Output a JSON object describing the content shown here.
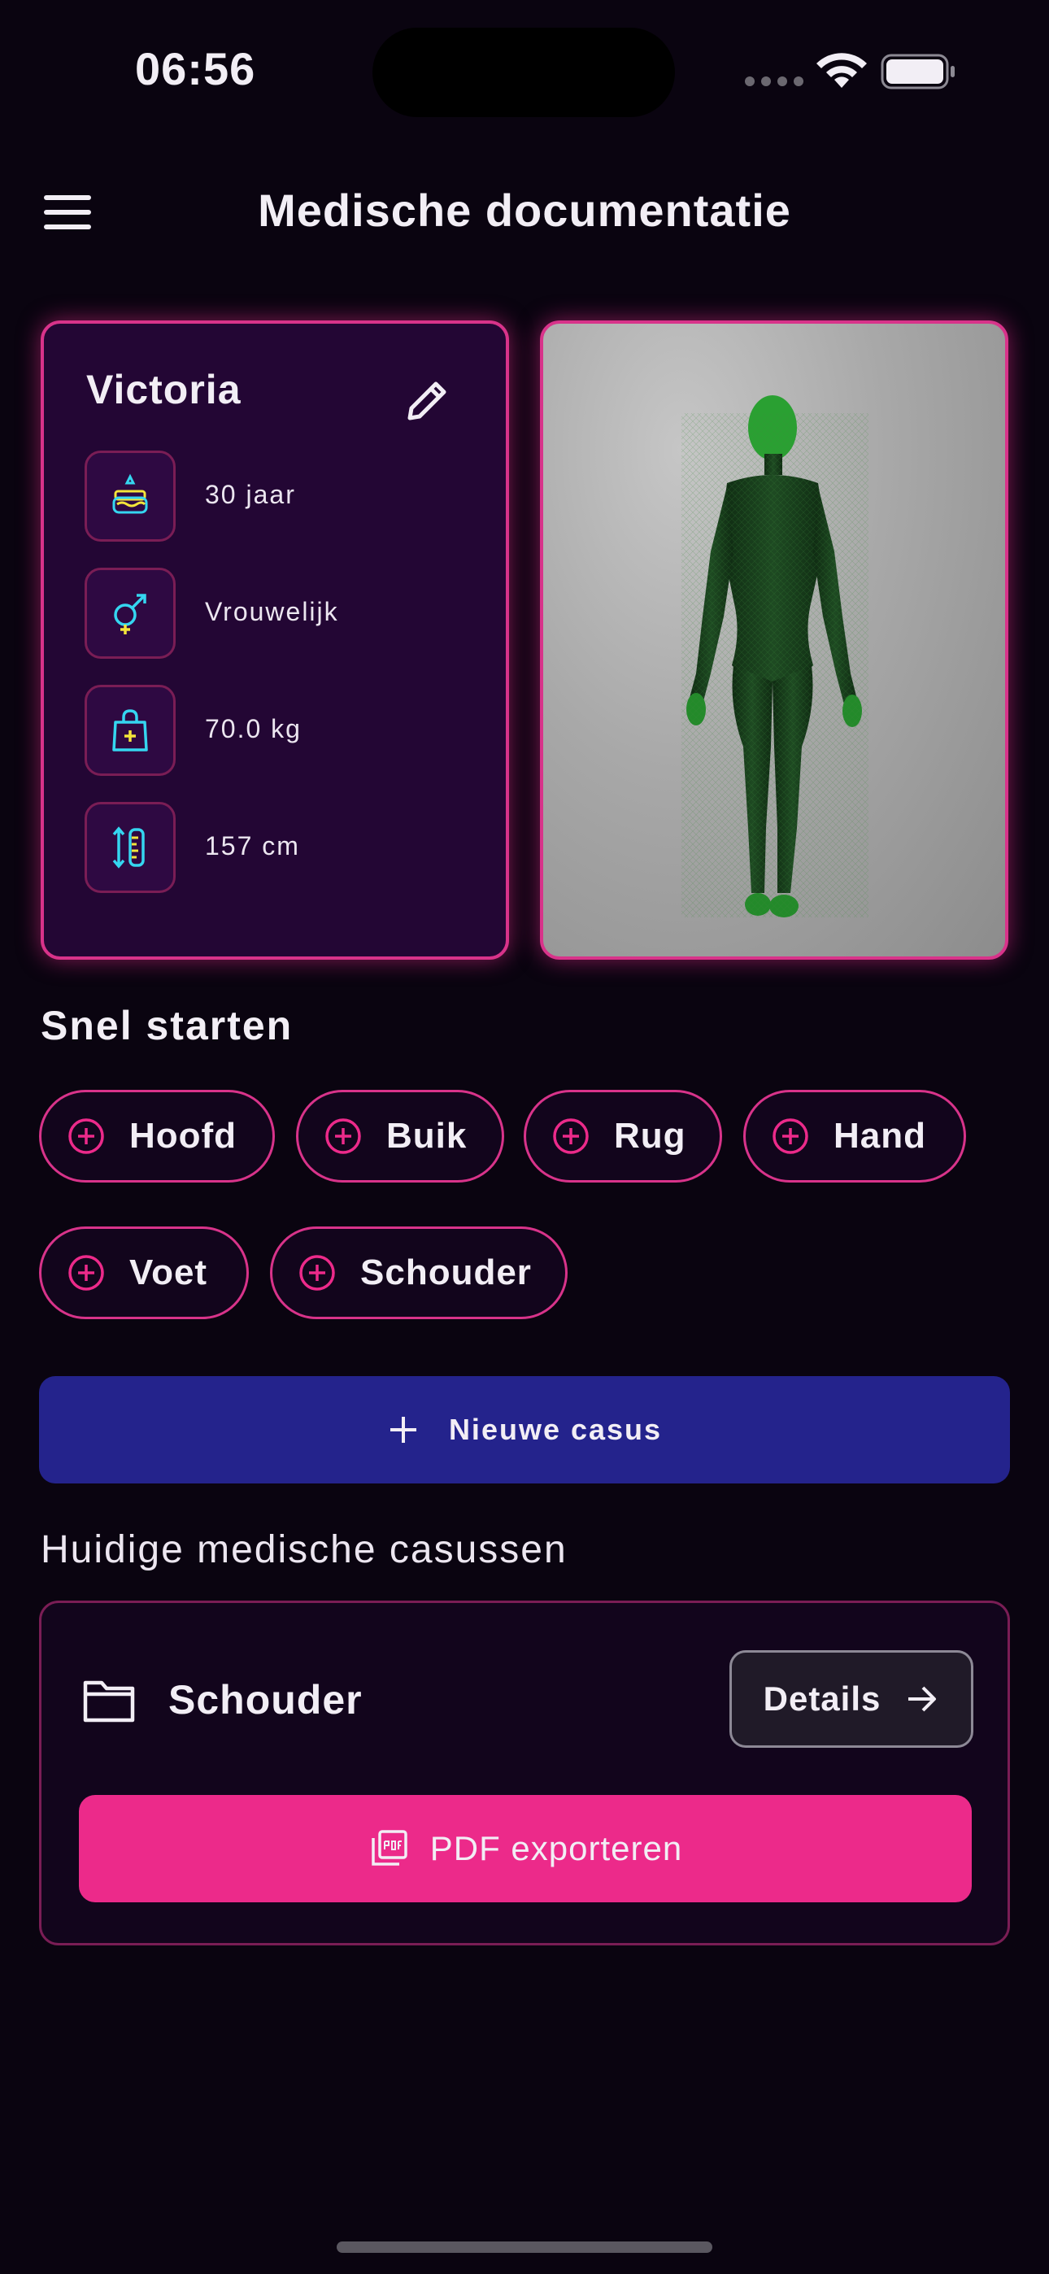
{
  "status_bar": {
    "time": "06:56"
  },
  "header": {
    "title": "Medische documentatie",
    "menu_icon": "hamburger-menu-icon"
  },
  "patient": {
    "name": "Victoria",
    "edit_icon": "pencil-icon",
    "info": [
      {
        "icon": "birthday-cake-icon",
        "text": "30 jaar"
      },
      {
        "icon": "gender-icon",
        "text": "Vrouwelijk"
      },
      {
        "icon": "weight-bag-icon",
        "text": "70.0 kg"
      },
      {
        "icon": "height-ruler-icon",
        "text": "157 cm"
      }
    ]
  },
  "quick_start": {
    "title": "Snel starten",
    "chips": [
      "Hoofd",
      "Buik",
      "Rug",
      "Hand",
      "Voet",
      "Schouder"
    ]
  },
  "new_case": {
    "label": "Nieuwe casus"
  },
  "current_cases": {
    "title": "Huidige medische casussen",
    "cases": [
      {
        "name": "Schouder",
        "details_label": "Details",
        "export_label": "PDF exporteren"
      }
    ]
  },
  "colors": {
    "accent_pink": "#ec2a8a",
    "card_bg": "#230634",
    "primary_blue": "#24238c",
    "icon_cyan": "#35d6f0",
    "icon_yellow": "#f4e53a"
  }
}
